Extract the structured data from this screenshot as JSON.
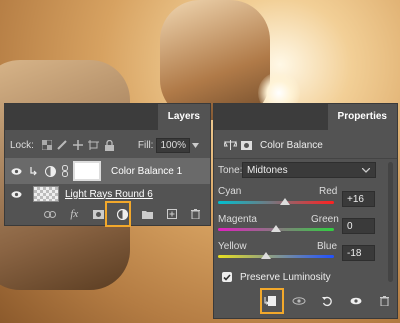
{
  "layers_panel": {
    "tab": "Layers",
    "lock_label": "Lock:",
    "fill_label": "Fill:",
    "fill_value": "100%",
    "layers": [
      {
        "name": "Color Balance 1"
      },
      {
        "name": "Light Rays Round 6"
      }
    ],
    "bottom_icons": [
      "link-icon",
      "fx-icon",
      "mask-icon",
      "adjustment-layer-icon",
      "group-folder-icon",
      "new-layer-icon",
      "trash-icon"
    ]
  },
  "properties_panel": {
    "tab": "Properties",
    "title": "Color Balance",
    "tone_label": "Tone:",
    "tone_value": "Midtones",
    "sliders": [
      {
        "left": "Cyan",
        "right": "Red",
        "value": "+16",
        "level": 16
      },
      {
        "left": "Magenta",
        "right": "Green",
        "value": "0",
        "level": 0
      },
      {
        "left": "Yellow",
        "right": "Blue",
        "value": "-18",
        "level": -18
      }
    ],
    "preserve_label": "Preserve Luminosity",
    "preserve_checked": true,
    "bottom_icons": [
      "clip-to-layer-icon",
      "view-previous-icon",
      "reset-icon",
      "visibility-icon",
      "trash-icon"
    ]
  },
  "colors": {
    "highlight": "#f2a82b",
    "panel": "#535353"
  }
}
